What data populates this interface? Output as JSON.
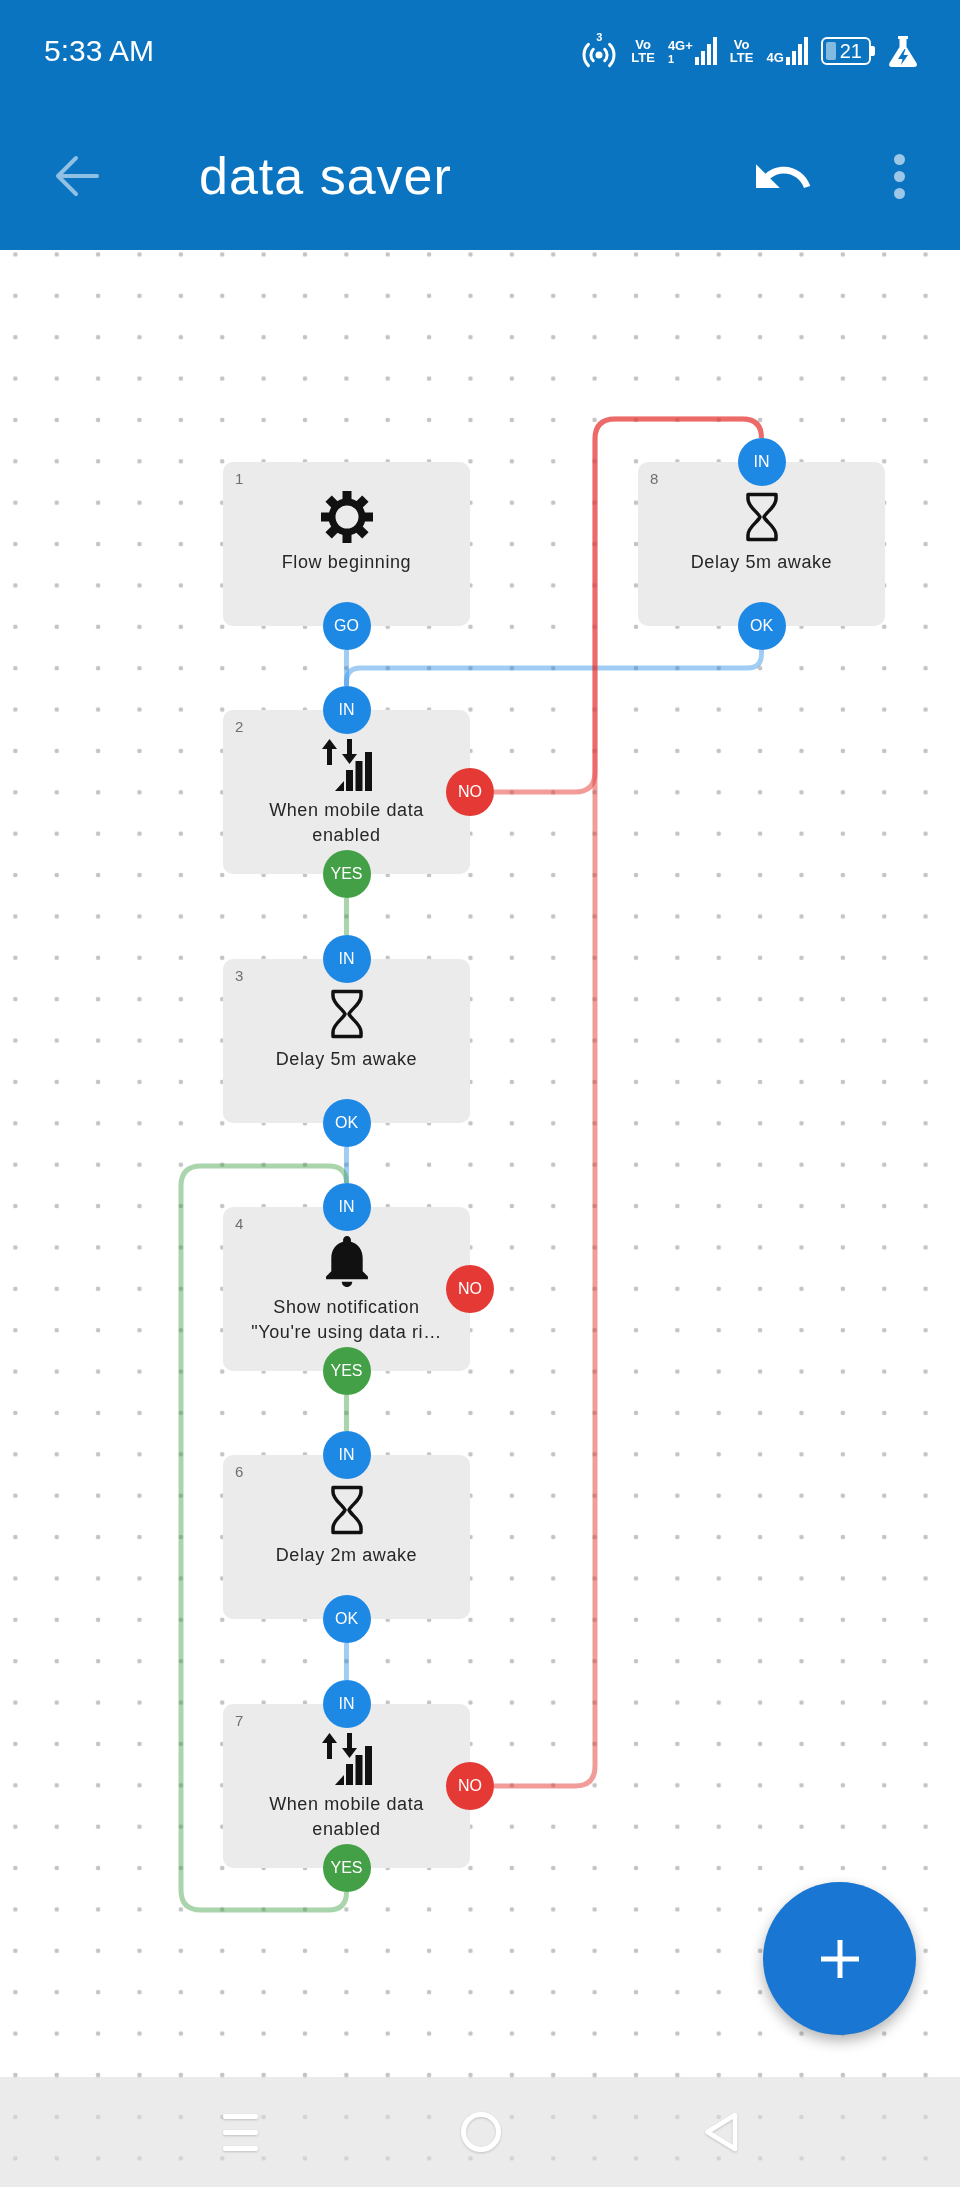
{
  "status_bar": {
    "time": "5:33 AM",
    "hotspot_count": "3",
    "sims": [
      {
        "volte": "Vo LTE",
        "network": "4G+",
        "sim": "1"
      },
      {
        "volte": "Vo LTE",
        "network": "4G"
      }
    ],
    "battery": "21"
  },
  "app_bar": {
    "title": "data saver"
  },
  "flow": {
    "nodes": [
      {
        "number": "1",
        "kind": "start",
        "label": "Flow beginning",
        "ports": [
          {
            "kind": "next",
            "label": "GO"
          }
        ]
      },
      {
        "number": "8",
        "kind": "delay",
        "label": "Delay 5m awake",
        "ports": [
          {
            "kind": "input",
            "label": "IN"
          },
          {
            "kind": "next",
            "label": "OK"
          }
        ]
      },
      {
        "number": "2",
        "kind": "mobile_data",
        "label": "When mobile data enabled",
        "ports": [
          {
            "kind": "input",
            "label": "IN"
          },
          {
            "kind": "no",
            "label": "NO"
          },
          {
            "kind": "yes",
            "label": "YES"
          }
        ]
      },
      {
        "number": "3",
        "kind": "delay",
        "label": "Delay 5m awake",
        "ports": [
          {
            "kind": "input",
            "label": "IN"
          },
          {
            "kind": "next",
            "label": "OK"
          }
        ]
      },
      {
        "number": "4",
        "kind": "notification",
        "label": "Show notification \"You're using data ri…",
        "ports": [
          {
            "kind": "input",
            "label": "IN"
          },
          {
            "kind": "no",
            "label": "NO"
          },
          {
            "kind": "yes",
            "label": "YES"
          }
        ]
      },
      {
        "number": "6",
        "kind": "delay",
        "label": "Delay 2m awake",
        "ports": [
          {
            "kind": "input",
            "label": "IN"
          },
          {
            "kind": "next",
            "label": "OK"
          }
        ]
      },
      {
        "number": "7",
        "kind": "mobile_data",
        "label": "When mobile data enabled",
        "ports": [
          {
            "kind": "input",
            "label": "IN"
          },
          {
            "kind": "no",
            "label": "NO"
          },
          {
            "kind": "yes",
            "label": "YES"
          }
        ]
      }
    ]
  }
}
